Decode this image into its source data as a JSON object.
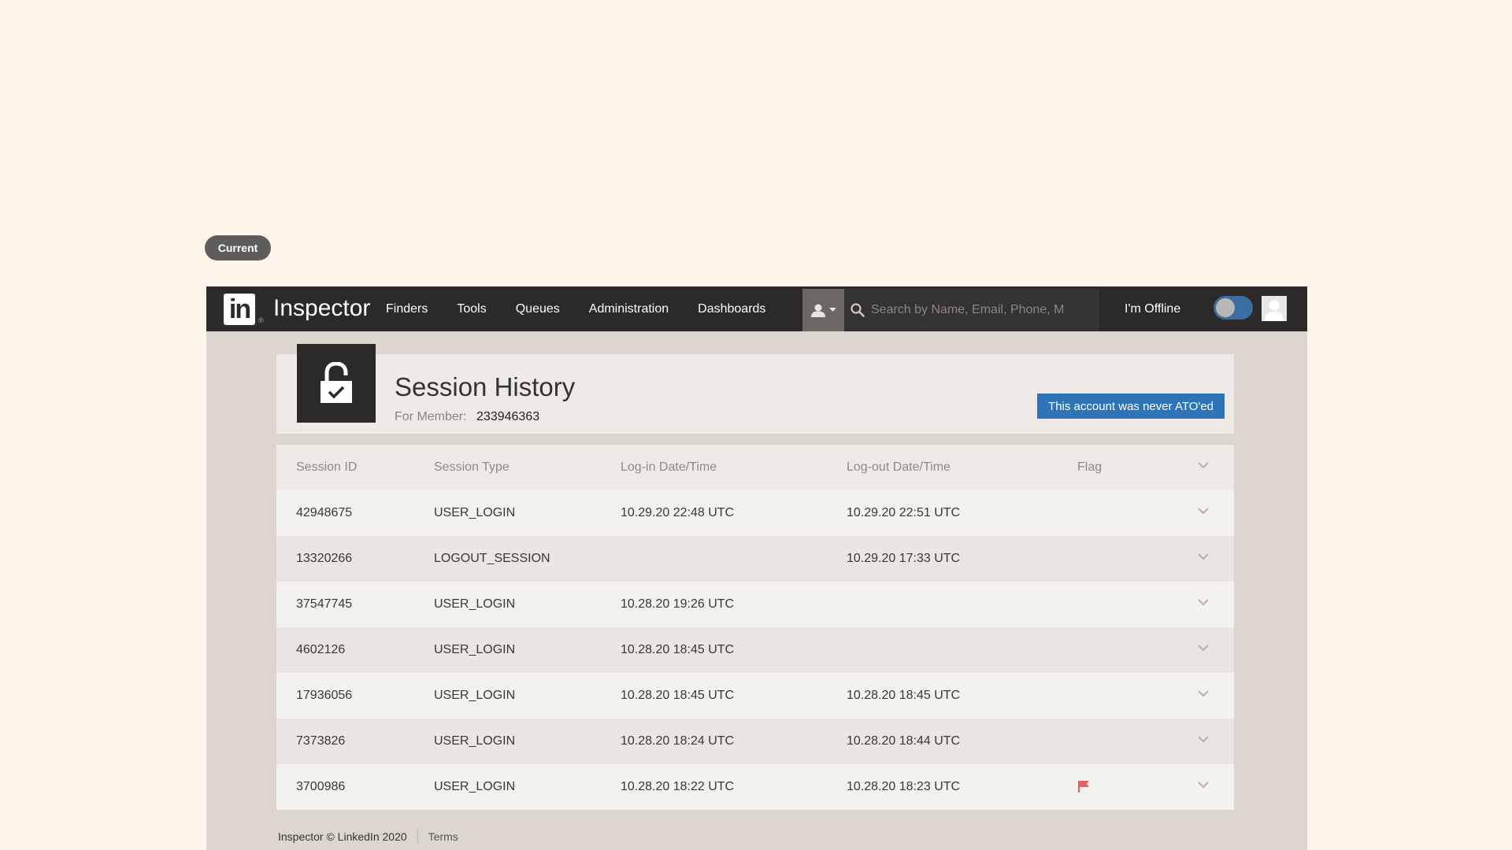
{
  "pill": {
    "label": "Current"
  },
  "nav": {
    "logo_text": "in",
    "logo_reg": "®",
    "app_title": "Inspector",
    "items": [
      "Finders",
      "Tools",
      "Queues",
      "Administration",
      "Dashboards"
    ],
    "search_placeholder": "Search by Name, Email, Phone, M",
    "offline_label": "I'm Offline",
    "toggle_on": false
  },
  "page": {
    "title": "Session History",
    "member_label": "For Member:",
    "member_id": "233946363",
    "ato_badge": "This account was never ATO'ed"
  },
  "table": {
    "headers": [
      "Session ID",
      "Session Type",
      "Log-in Date/Time",
      "Log-out Date/Time",
      "Flag"
    ],
    "rows": [
      {
        "id": "42948675",
        "type": "USER_LOGIN",
        "login": "10.29.20 22:48 UTC",
        "logout": "10.29.20 22:51 UTC",
        "flagged": false
      },
      {
        "id": "13320266",
        "type": "LOGOUT_SESSION",
        "login": "",
        "logout": "10.29.20 17:33 UTC",
        "flagged": false
      },
      {
        "id": "37547745",
        "type": "USER_LOGIN",
        "login": "10.28.20 19:26 UTC",
        "logout": "",
        "flagged": false
      },
      {
        "id": "4602126",
        "type": "USER_LOGIN",
        "login": "10.28.20 18:45 UTC",
        "logout": "",
        "flagged": false
      },
      {
        "id": "17936056",
        "type": "USER_LOGIN",
        "login": "10.28.20 18:45 UTC",
        "logout": "10.28.20 18:45 UTC",
        "flagged": false
      },
      {
        "id": "7373826",
        "type": "USER_LOGIN",
        "login": "10.28.20 18:24 UTC",
        "logout": "10.28.20 18:44 UTC",
        "flagged": false
      },
      {
        "id": "3700986",
        "type": "USER_LOGIN",
        "login": "10.28.20 18:22 UTC",
        "logout": "10.28.20 18:23 UTC",
        "flagged": true
      }
    ]
  },
  "footer": {
    "copyright": "Inspector © LinkedIn 2020",
    "terms": "Terms"
  },
  "colors": {
    "brand_dark": "#2b2a29",
    "accent_blue": "#2f74b5",
    "flag_red": "#e06464",
    "background": "#fdf4ea"
  },
  "icons": [
    "lock-check-icon",
    "person-icon",
    "caret-down-icon",
    "search-icon",
    "chevron-down-icon",
    "flag-icon",
    "avatar-icon"
  ]
}
